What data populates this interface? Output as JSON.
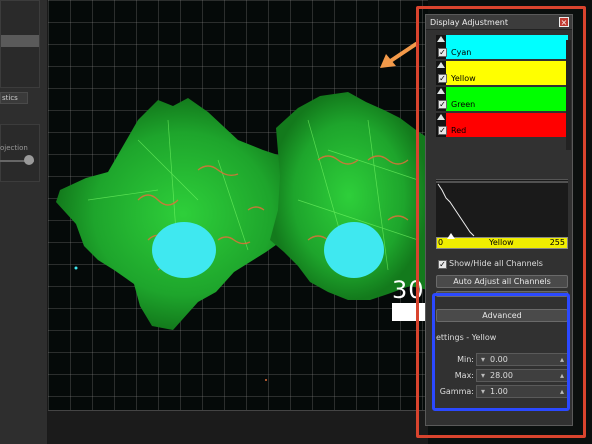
{
  "left_panel": {
    "tab_label": "stics",
    "projection_label": "ojection"
  },
  "viewer": {
    "scale_label": "30"
  },
  "display_adjustment": {
    "title": "Display Adjustment",
    "close_icon": "close-icon",
    "channels": [
      {
        "name": "Cyan",
        "color": "#00ffff",
        "checked": true
      },
      {
        "name": "Yellow",
        "color": "#ffff00",
        "checked": true
      },
      {
        "name": "Green",
        "color": "#00ff00",
        "checked": true
      },
      {
        "name": "Red",
        "color": "#ff0000",
        "checked": true
      }
    ],
    "range": {
      "min": "0",
      "channel": "Yellow",
      "max": "255"
    },
    "show_hide_label": "Show/Hide all Channels",
    "auto_adjust_label": "Auto Adjust all Channels",
    "advanced_label": "Advanced",
    "settings_label": "ettings - Yellow",
    "fields": [
      {
        "label": "Min:",
        "value": "0.00"
      },
      {
        "label": "Max:",
        "value": "28.00"
      },
      {
        "label": "Gamma:",
        "value": "1.00"
      }
    ]
  },
  "annotations": {
    "arrow_color": "#f39a4a",
    "red_outline_color": "#d9442e",
    "blue_outline_color": "#2b49ff"
  }
}
